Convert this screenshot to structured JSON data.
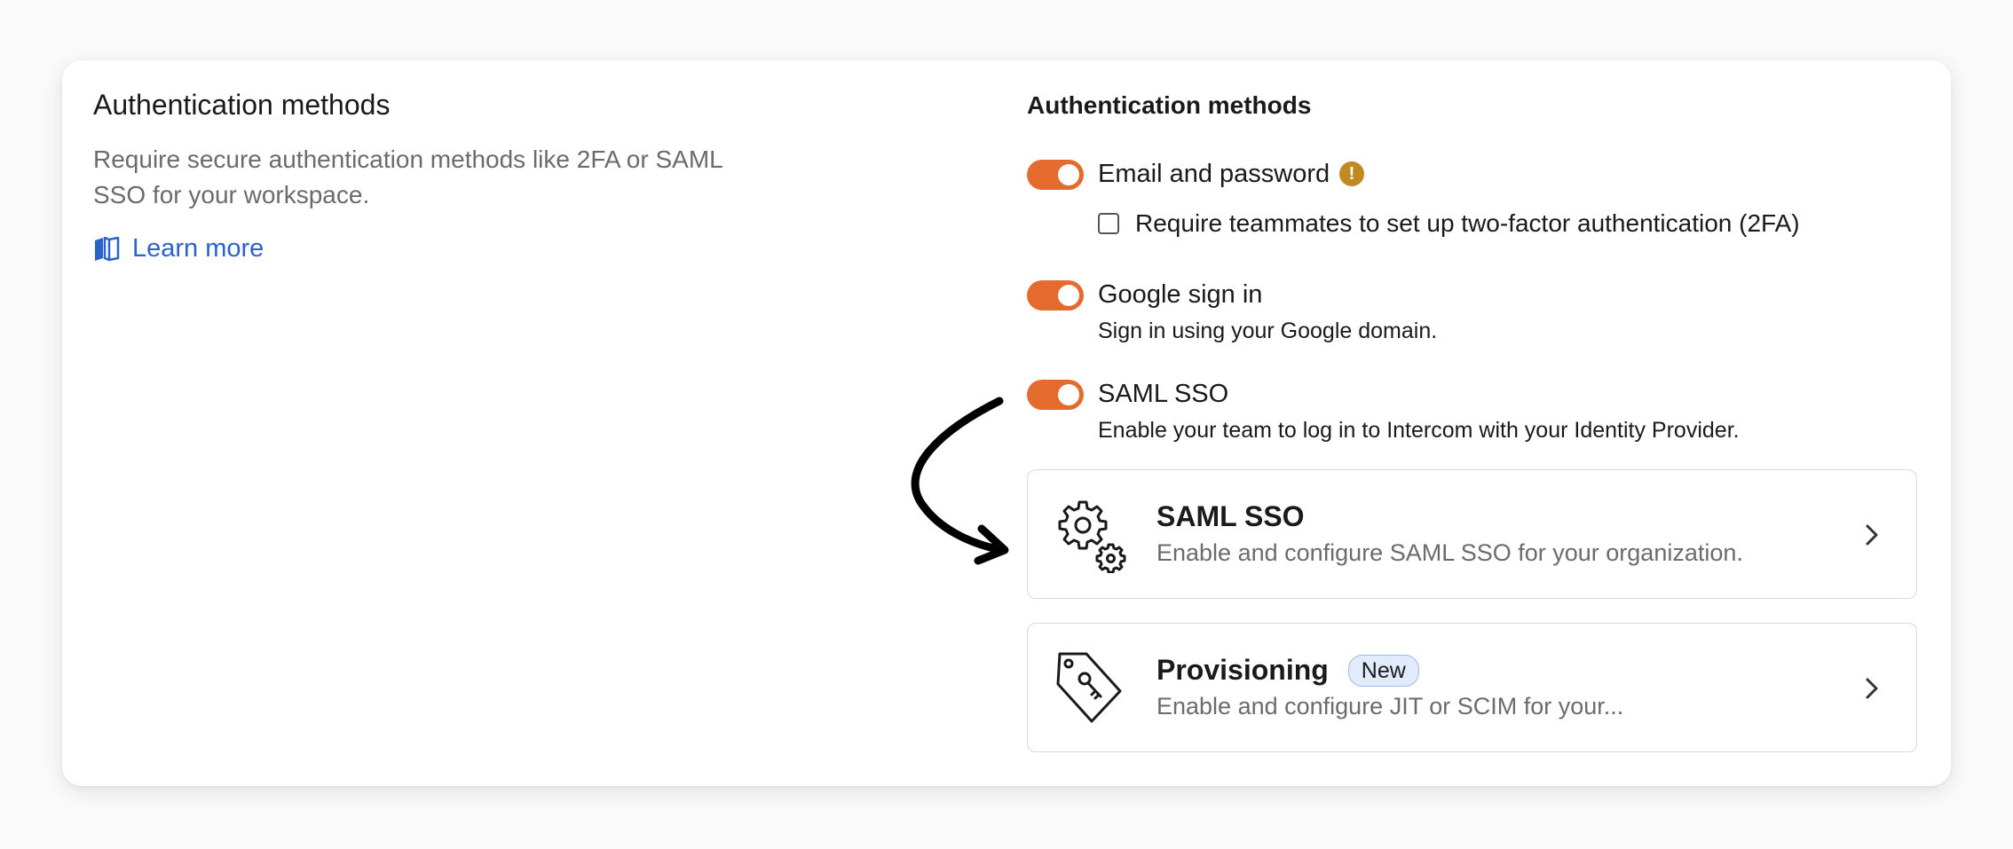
{
  "left": {
    "title": "Authentication methods",
    "description": "Require secure authentication methods like 2FA or SAML SSO for your workspace.",
    "learn_more": "Learn more",
    "learn_more_icon": "book-icon"
  },
  "right": {
    "title": "Authentication methods",
    "options": [
      {
        "label": "Email and password",
        "enabled": true,
        "warning_icon": "!",
        "checkbox_label": "Require teammates to set up two-factor authentication (2FA)",
        "checkbox_checked": false
      },
      {
        "label": "Google sign in",
        "enabled": true,
        "description": "Sign in using your Google domain."
      },
      {
        "label": "SAML SSO",
        "enabled": true,
        "description": "Enable your team to log in to Intercom with your Identity Provider."
      }
    ],
    "cards": [
      {
        "title": "SAML SSO",
        "description": "Enable and configure SAML SSO for your organization.",
        "icon": "gears-icon"
      },
      {
        "title": "Provisioning",
        "badge": "New",
        "description": "Enable and configure JIT or SCIM for your...",
        "icon": "tag-key-icon"
      }
    ]
  },
  "colors": {
    "toggle_on": "#e46a2e",
    "link": "#2c62c9",
    "warning": "#c08a22",
    "badge_bg": "#e1ebfb"
  }
}
